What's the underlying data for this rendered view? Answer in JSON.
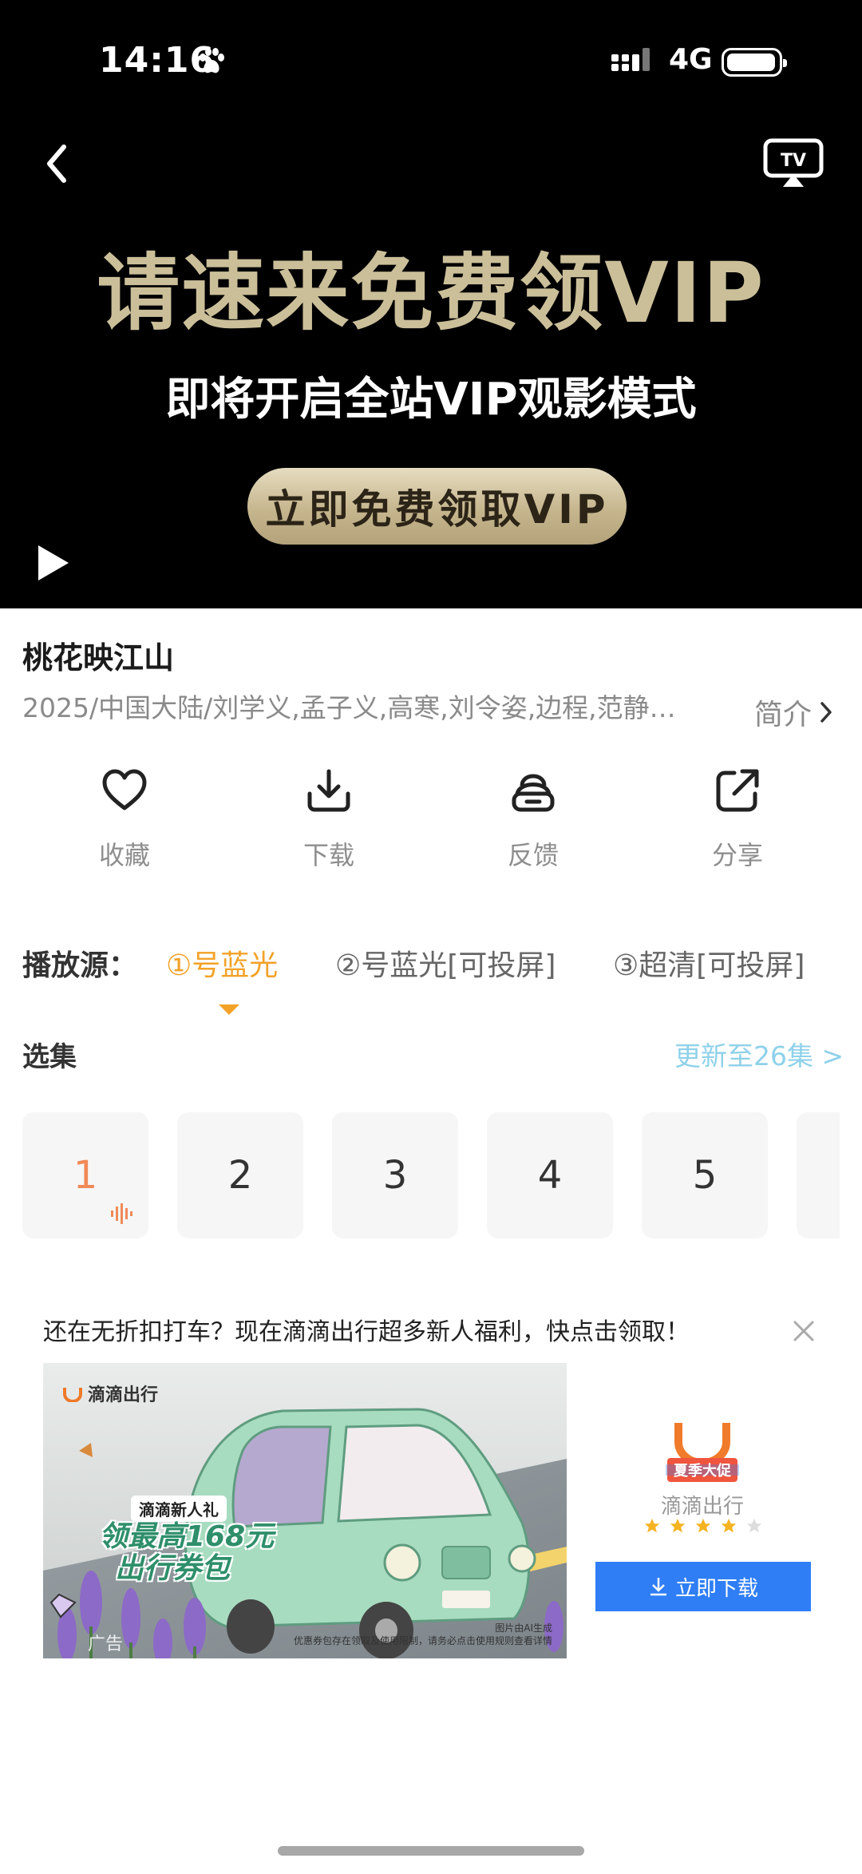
{
  "status_bar": {
    "time": "14:16",
    "network": "4G",
    "icons": [
      "paw-icon",
      "signal-icon",
      "battery-icon"
    ]
  },
  "player": {
    "promo_title": "请速来免费领VIP",
    "promo_subtitle": "即将开启全站VIP观影模式",
    "promo_button": "立即免费领取VIP",
    "icons": [
      "back-icon",
      "cast-tv-icon",
      "play-icon"
    ],
    "colors": {
      "gold": "#cbbf9a"
    }
  },
  "show": {
    "title": "桃花映江山",
    "meta": "2025/中国大陆/刘学义,孟子义,高寒,刘令姿,边程,范静…",
    "intro_label": "简介"
  },
  "actions": [
    {
      "label": "收藏",
      "icon": "heart-icon"
    },
    {
      "label": "下载",
      "icon": "download-icon"
    },
    {
      "label": "反馈",
      "icon": "feedback-icon"
    },
    {
      "label": "分享",
      "icon": "share-icon"
    }
  ],
  "sources": {
    "label": "播放源：",
    "tabs": [
      "①号蓝光",
      "②号蓝光[可投屏]",
      "③超清[可投屏]"
    ],
    "active_index": 0,
    "active_color": "#f3a228"
  },
  "episodes": {
    "label": "选集",
    "update_text": "更新至26集 >",
    "items": [
      "1",
      "2",
      "3",
      "4",
      "5",
      ""
    ],
    "current": "1"
  },
  "ad": {
    "text": "还在无折扣打车？现在滴滴出行超多新人福利，快点击领取！",
    "image_brand": "滴滴出行",
    "image_badge": "滴滴新人礼",
    "image_headline_1": "领最高168元",
    "image_headline_2": "出行券包",
    "image_tag": "广告",
    "image_note": "图片由AI生成",
    "image_disclaimer": "优惠券包存在领取及使用限制，请务必点击使用规则查看详情",
    "app_icon_text": "夏季大促",
    "app_name": "滴滴出行",
    "rating": 4,
    "rating_max": 5,
    "download_label": "立即下载",
    "download_color": "#2f7ef6"
  }
}
